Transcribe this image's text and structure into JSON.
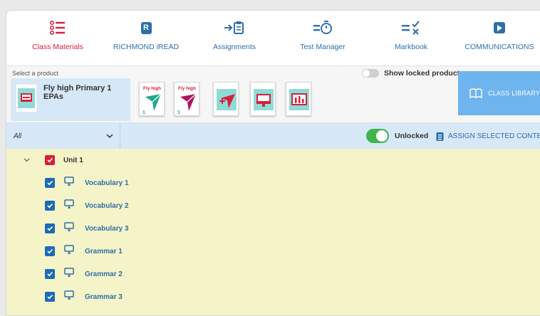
{
  "nav": {
    "items": [
      {
        "label": "Class Materials",
        "icon": "list-icon",
        "active": true
      },
      {
        "label": "RICHMOND iREAD",
        "icon": "r-badge-icon"
      },
      {
        "label": "Assignments",
        "icon": "assign-clipboard-icon"
      },
      {
        "label": "Test Manager",
        "icon": "stopwatch-icon"
      },
      {
        "label": "Markbook",
        "icon": "markbook-icon"
      },
      {
        "label": "COMMUNICATIONS",
        "icon": "play-badge-icon"
      }
    ],
    "r_badge_letter": "R"
  },
  "products": {
    "select_label": "Select a product",
    "selected_name": "Fly high Primary 1 EPAs",
    "thumb_brand": "Fly high",
    "thumb_number": "1",
    "show_locked_label": "Show locked products",
    "show_locked_on": false,
    "class_library_label": "CLASS LIBRARY"
  },
  "filter": {
    "value": "All",
    "unlocked_label": "Unlocked",
    "unlocked_on": true,
    "assign_label": "ASSIGN SELECTED CONTENT"
  },
  "list": {
    "unit": {
      "label": "Unit 1",
      "checked": true
    },
    "items": [
      {
        "label": "Vocabulary 1",
        "checked": true
      },
      {
        "label": "Vocabulary 2",
        "checked": true
      },
      {
        "label": "Vocabulary 3",
        "checked": true
      },
      {
        "label": "Grammar 1",
        "checked": true
      },
      {
        "label": "Grammar 2",
        "checked": true
      },
      {
        "label": "Grammar 3",
        "checked": true
      }
    ]
  },
  "colors": {
    "accent_red": "#d6203c",
    "accent_blue": "#2f6fa8",
    "list_bg": "#f5f4c8",
    "filter_bg": "#d7e8f8",
    "library_bg": "#6eb4ef",
    "toggle_on": "#3fb44f"
  }
}
